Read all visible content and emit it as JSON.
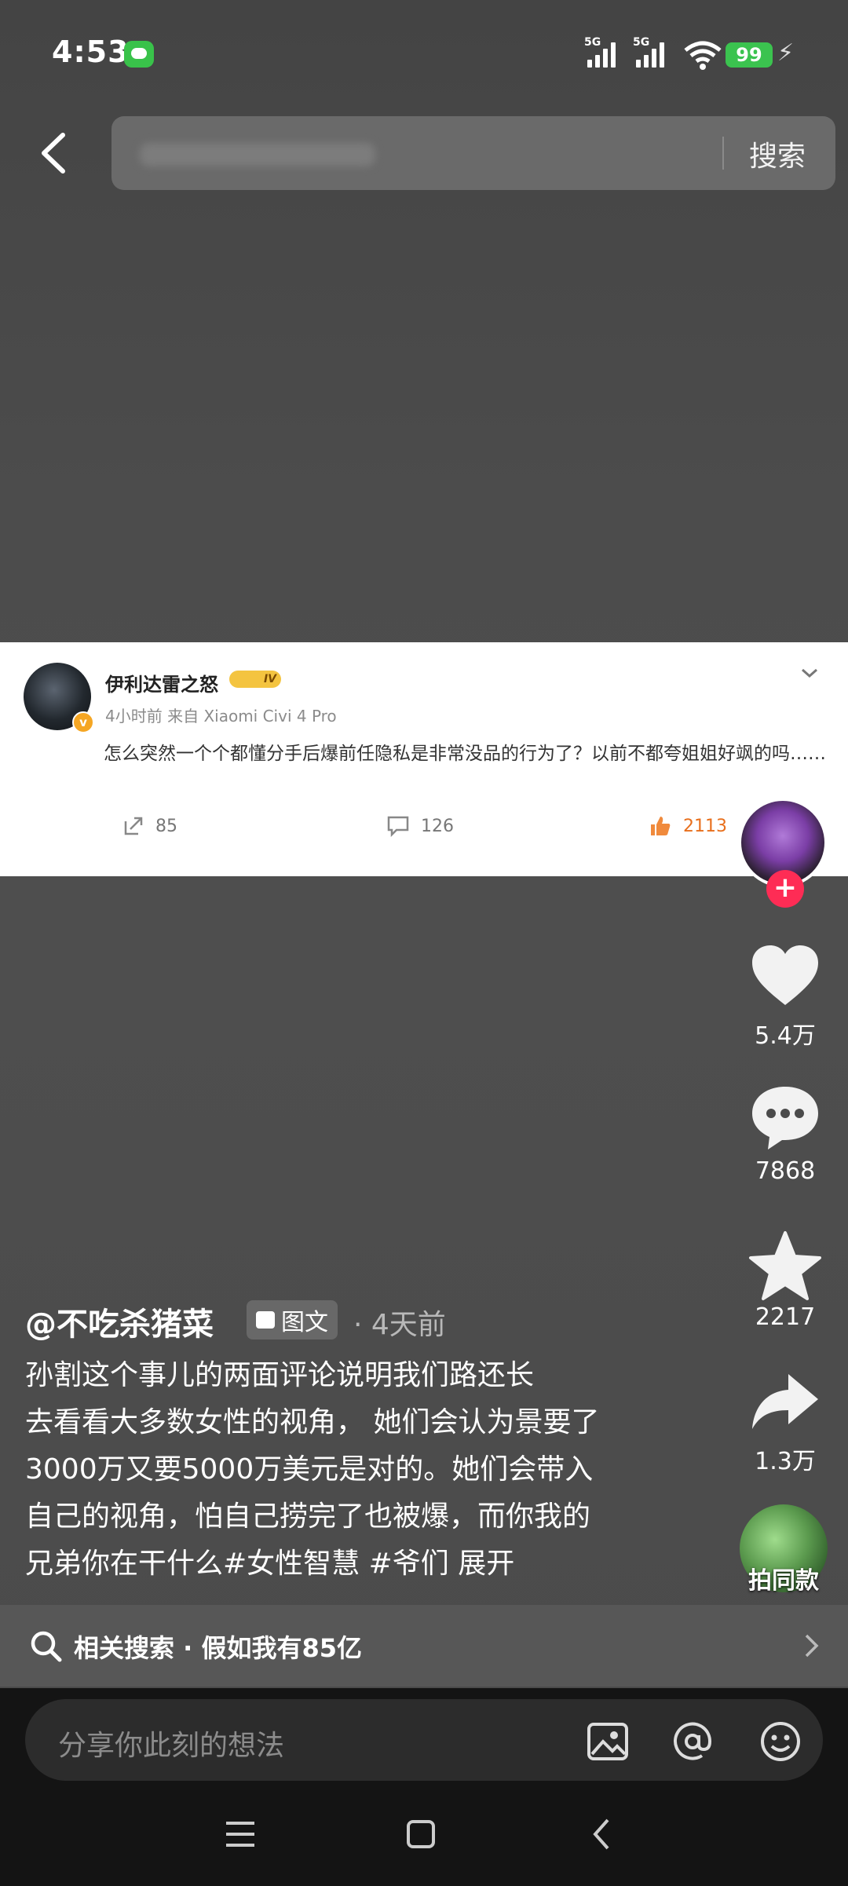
{
  "status": {
    "time": "4:53",
    "net1": "5G",
    "net2": "5G",
    "battery": "99"
  },
  "search": {
    "button": "搜索"
  },
  "weibo": {
    "username": "伊利达雷之怒",
    "level": "IV",
    "meta": "4小时前  来自 Xiaomi Civi 4 Pro",
    "text": "怎么突然一个个都懂分手后爆前任隐私是非常没品的行为了？以前不都夸姐姐好飒的吗……",
    "reposts": "85",
    "comments": "126",
    "likes": "2113"
  },
  "actions": {
    "like": "5.4万",
    "comment": "7868",
    "favorite": "2217",
    "share": "1.3万",
    "remix": "拍同款"
  },
  "post": {
    "author": "@不吃杀猪菜",
    "type": "图文",
    "time": "· 4天前",
    "lines": [
      "孙割这个事儿的两面评论说明我们路还长",
      "去看看大多数女性的视角， 她们会认为景要了",
      "3000万又要5000万美元是对的。她们会带入",
      "自己的视角，怕自己捞完了也被爆，而你我的"
    ],
    "last_line": "兄弟你在干什么#女性智慧 #爷们 展开"
  },
  "related": {
    "text": "相关搜索 · 假如我有85亿"
  },
  "comment": {
    "placeholder": "分享你此刻的想法"
  }
}
